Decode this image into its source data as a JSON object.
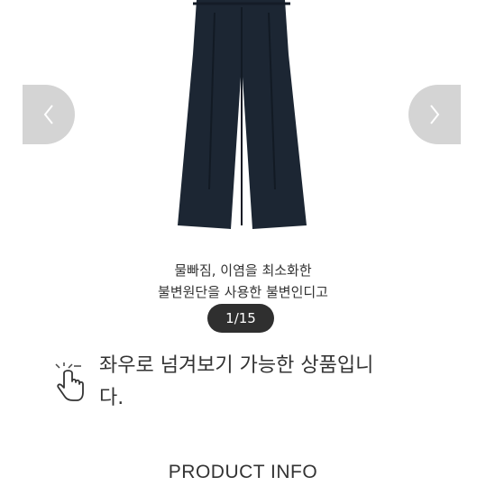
{
  "carousel": {
    "caption_lines": [
      "물빠짐, 이염을 최소화한",
      "불변원단을 사용한 불변인디고"
    ],
    "counter": "1/15",
    "prev_icon": "chevron-left-icon",
    "next_icon": "chevron-right-icon"
  },
  "swipe_notice": {
    "icon": "hand-swipe-icon",
    "lines": [
      "좌우로 넘겨보기 가능한 상품입니",
      "다."
    ]
  },
  "section": {
    "title": "PRODUCT INFO"
  },
  "colors": {
    "pants": "#1c2633",
    "nav_button": "#d4d4d4",
    "counter_bg": "#2f2f2f"
  }
}
